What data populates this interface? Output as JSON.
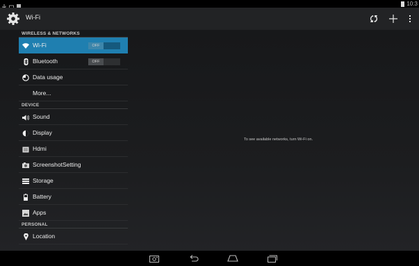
{
  "status_bar": {
    "time": "10:3"
  },
  "action_bar": {
    "title": "Wi-Fi",
    "icons": [
      "settings-gear-icon",
      "wps-icon",
      "add-icon",
      "overflow-menu-icon"
    ]
  },
  "sidebar": {
    "sections": [
      {
        "header": "WIRELESS & NETWORKS",
        "items": [
          {
            "label": "Wi-Fi",
            "icon": "wifi-icon",
            "selected": true,
            "toggle": "OFF"
          },
          {
            "label": "Bluetooth",
            "icon": "bluetooth-icon",
            "toggle": "OFF"
          },
          {
            "label": "Data usage",
            "icon": "data-usage-icon"
          },
          {
            "label": "More..."
          }
        ]
      },
      {
        "header": "DEVICE",
        "items": [
          {
            "label": "Sound",
            "icon": "speaker-icon"
          },
          {
            "label": "Display",
            "icon": "display-icon"
          },
          {
            "label": "Hdmi",
            "icon": "hdmi-icon"
          },
          {
            "label": "ScreenshotSetting",
            "icon": "camera-icon"
          },
          {
            "label": "Storage",
            "icon": "storage-icon"
          },
          {
            "label": "Battery",
            "icon": "battery-icon"
          },
          {
            "label": "Apps",
            "icon": "apps-icon"
          }
        ]
      },
      {
        "header": "PERSONAL",
        "items": [
          {
            "label": "Location",
            "icon": "location-icon"
          }
        ]
      }
    ]
  },
  "main": {
    "message": "To see available networks, turn Wi-Fi on."
  },
  "colors": {
    "accent": "#1f7fb0",
    "background": "#1a1b1d",
    "action_bar": "#222325"
  },
  "nav_bar": {
    "icons": [
      "screenshot-icon",
      "back-icon",
      "home-icon",
      "recents-icon"
    ]
  }
}
